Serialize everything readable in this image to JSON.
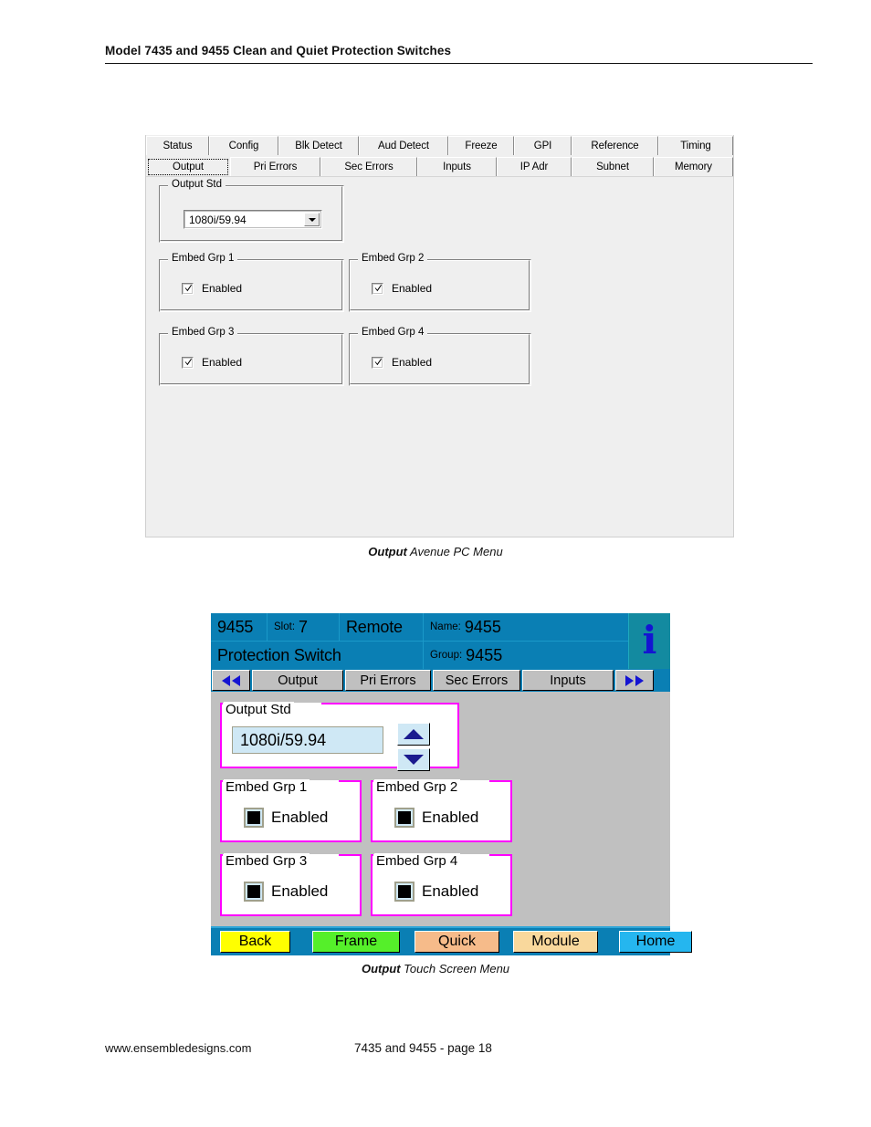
{
  "document": {
    "header_title": "Model 7435 and 9455 Clean and Quiet Protection Switches",
    "footer_url": "www.ensembledesigns.com",
    "footer_page": "7435 and 9455 - page 18"
  },
  "captions": {
    "pc_menu_bold": "Output",
    "pc_menu_rest": " Avenue PC Menu",
    "touch_menu_bold": "Output",
    "touch_menu_rest": " Touch Screen Menu"
  },
  "pc_menu": {
    "tabs_row1": [
      {
        "label": "Status",
        "selected": false
      },
      {
        "label": "Config",
        "selected": false
      },
      {
        "label": "Blk Detect",
        "selected": false
      },
      {
        "label": "Aud Detect",
        "selected": false
      },
      {
        "label": "Freeze",
        "selected": false
      },
      {
        "label": "GPI",
        "selected": false
      },
      {
        "label": "Reference",
        "selected": false
      },
      {
        "label": "Timing",
        "selected": false
      }
    ],
    "tabs_row2": [
      {
        "label": "Output",
        "selected": true
      },
      {
        "label": "Pri Errors",
        "selected": false
      },
      {
        "label": "Sec Errors",
        "selected": false
      },
      {
        "label": "Inputs",
        "selected": false
      },
      {
        "label": "IP Adr",
        "selected": false
      },
      {
        "label": "Subnet",
        "selected": false
      },
      {
        "label": "Memory",
        "selected": false
      }
    ],
    "output_std": {
      "group_title": "Output Std",
      "value": "1080i/59.94"
    },
    "embed_groups": [
      {
        "group_title": "Embed Grp 1",
        "checkbox_label": "Enabled",
        "checked": true
      },
      {
        "group_title": "Embed Grp 2",
        "checkbox_label": "Enabled",
        "checked": true
      },
      {
        "group_title": "Embed Grp 3",
        "checkbox_label": "Enabled",
        "checked": true
      },
      {
        "group_title": "Embed Grp 4",
        "checkbox_label": "Enabled",
        "checked": true
      }
    ]
  },
  "touch_menu": {
    "header": {
      "model": "9455",
      "slot_label": "Slot:",
      "slot_value": "7",
      "mode": "Remote",
      "name_label": "Name:",
      "name_value": "9455",
      "device_type": "Protection Switch",
      "group_label": "Group:",
      "group_value": "9455",
      "info_icon": "i"
    },
    "tabs": [
      {
        "label": "Output",
        "selected": true
      },
      {
        "label": "Pri Errors",
        "selected": false
      },
      {
        "label": "Sec Errors",
        "selected": false
      },
      {
        "label": "Inputs",
        "selected": false
      }
    ],
    "nav_prev": "prev-tabs-arrows",
    "nav_next": "next-tabs-arrows",
    "output_std": {
      "group_title": "Output Std",
      "value": "1080i/59.94",
      "spin_up": "increment",
      "spin_down": "decrement"
    },
    "embed_groups": [
      {
        "group_title": "Embed Grp 1",
        "checkbox_label": "Enabled",
        "checked": true
      },
      {
        "group_title": "Embed Grp 2",
        "checkbox_label": "Enabled",
        "checked": true
      },
      {
        "group_title": "Embed Grp 3",
        "checkbox_label": "Enabled",
        "checked": true
      },
      {
        "group_title": "Embed Grp 4",
        "checkbox_label": "Enabled",
        "checked": true
      }
    ],
    "footer_buttons": [
      {
        "label": "Back",
        "color": "#ffff00"
      },
      {
        "label": "Frame",
        "color": "#55ef2a"
      },
      {
        "label": "Quick",
        "color": "#f6bb8a"
      },
      {
        "label": "Module",
        "color": "#f9d89c"
      },
      {
        "label": "Home",
        "color": "#25b6ef"
      }
    ]
  },
  "colors": {
    "touch_header_blue": "#0a7fb4",
    "magenta_border": "#ff00ff",
    "value_field_blue": "#cfe8f5",
    "info_icon_blue": "#1414d2",
    "pc_panel_gray": "#efefef",
    "touch_body_gray": "#c0c0c0"
  }
}
